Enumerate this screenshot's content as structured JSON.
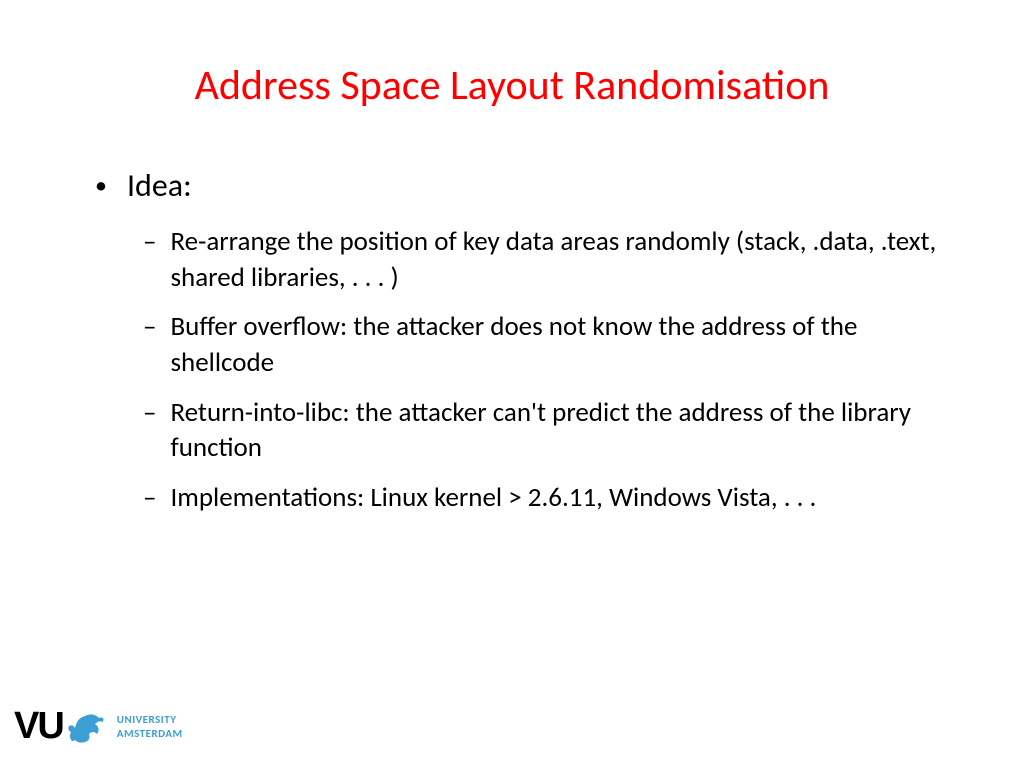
{
  "title": "Address Space Layout Randomisation",
  "bullets": {
    "main": "Idea:",
    "sub": [
      "Re-arrange the position of key data areas randomly (stack, .data, .text, shared libraries, . . . )",
      "Buffer overflow: the attacker does not know the address of the shellcode",
      "Return-into-libc: the attacker can't predict the address of the library function",
      "Implementations: Linux kernel > 2.6.11, Windows Vista, . . ."
    ]
  },
  "logo": {
    "vu": "VU",
    "line1": "UNIVERSITY",
    "line2": "AMSTERDAM"
  }
}
